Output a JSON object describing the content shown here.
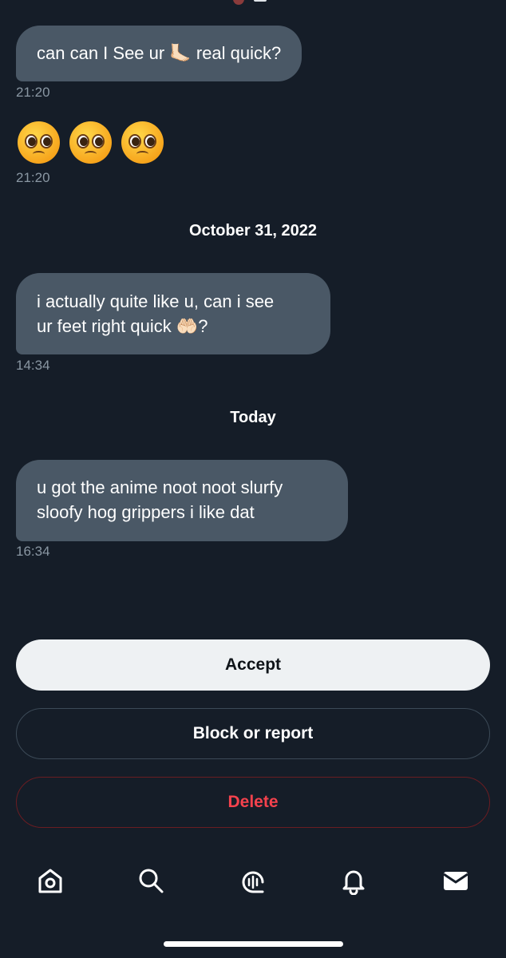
{
  "messages": [
    {
      "text_before": "can can I See ur",
      "emoji": "🦶🏻",
      "text_after": "real quick?",
      "time": "21:20"
    },
    {
      "emoji_row": [
        "pleading-face",
        "pleading-face",
        "pleading-face"
      ],
      "time": "21:20"
    },
    {
      "text_line1": "i actually quite like u, can i see",
      "text_line2_before": "ur feet right quick",
      "emoji": "🤲🏻",
      "text_line2_after": "?",
      "time": "14:34"
    },
    {
      "text_line1": "u got the anime noot noot slurfy",
      "text_line2": "sloofy hog grippers i like dat",
      "time": "16:34"
    }
  ],
  "date_separators": [
    "October 31, 2022",
    "Today"
  ],
  "actions": {
    "accept": "Accept",
    "block": "Block or report",
    "delete": "Delete"
  },
  "nav_icons": [
    "home-icon",
    "search-icon",
    "spaces-icon",
    "notifications-bell-icon",
    "messages-envelope-icon"
  ],
  "colors": {
    "background": "#151d28",
    "bubble": "#4a5866",
    "delete_text": "#f4424d",
    "accept_bg": "#eef1f3"
  }
}
